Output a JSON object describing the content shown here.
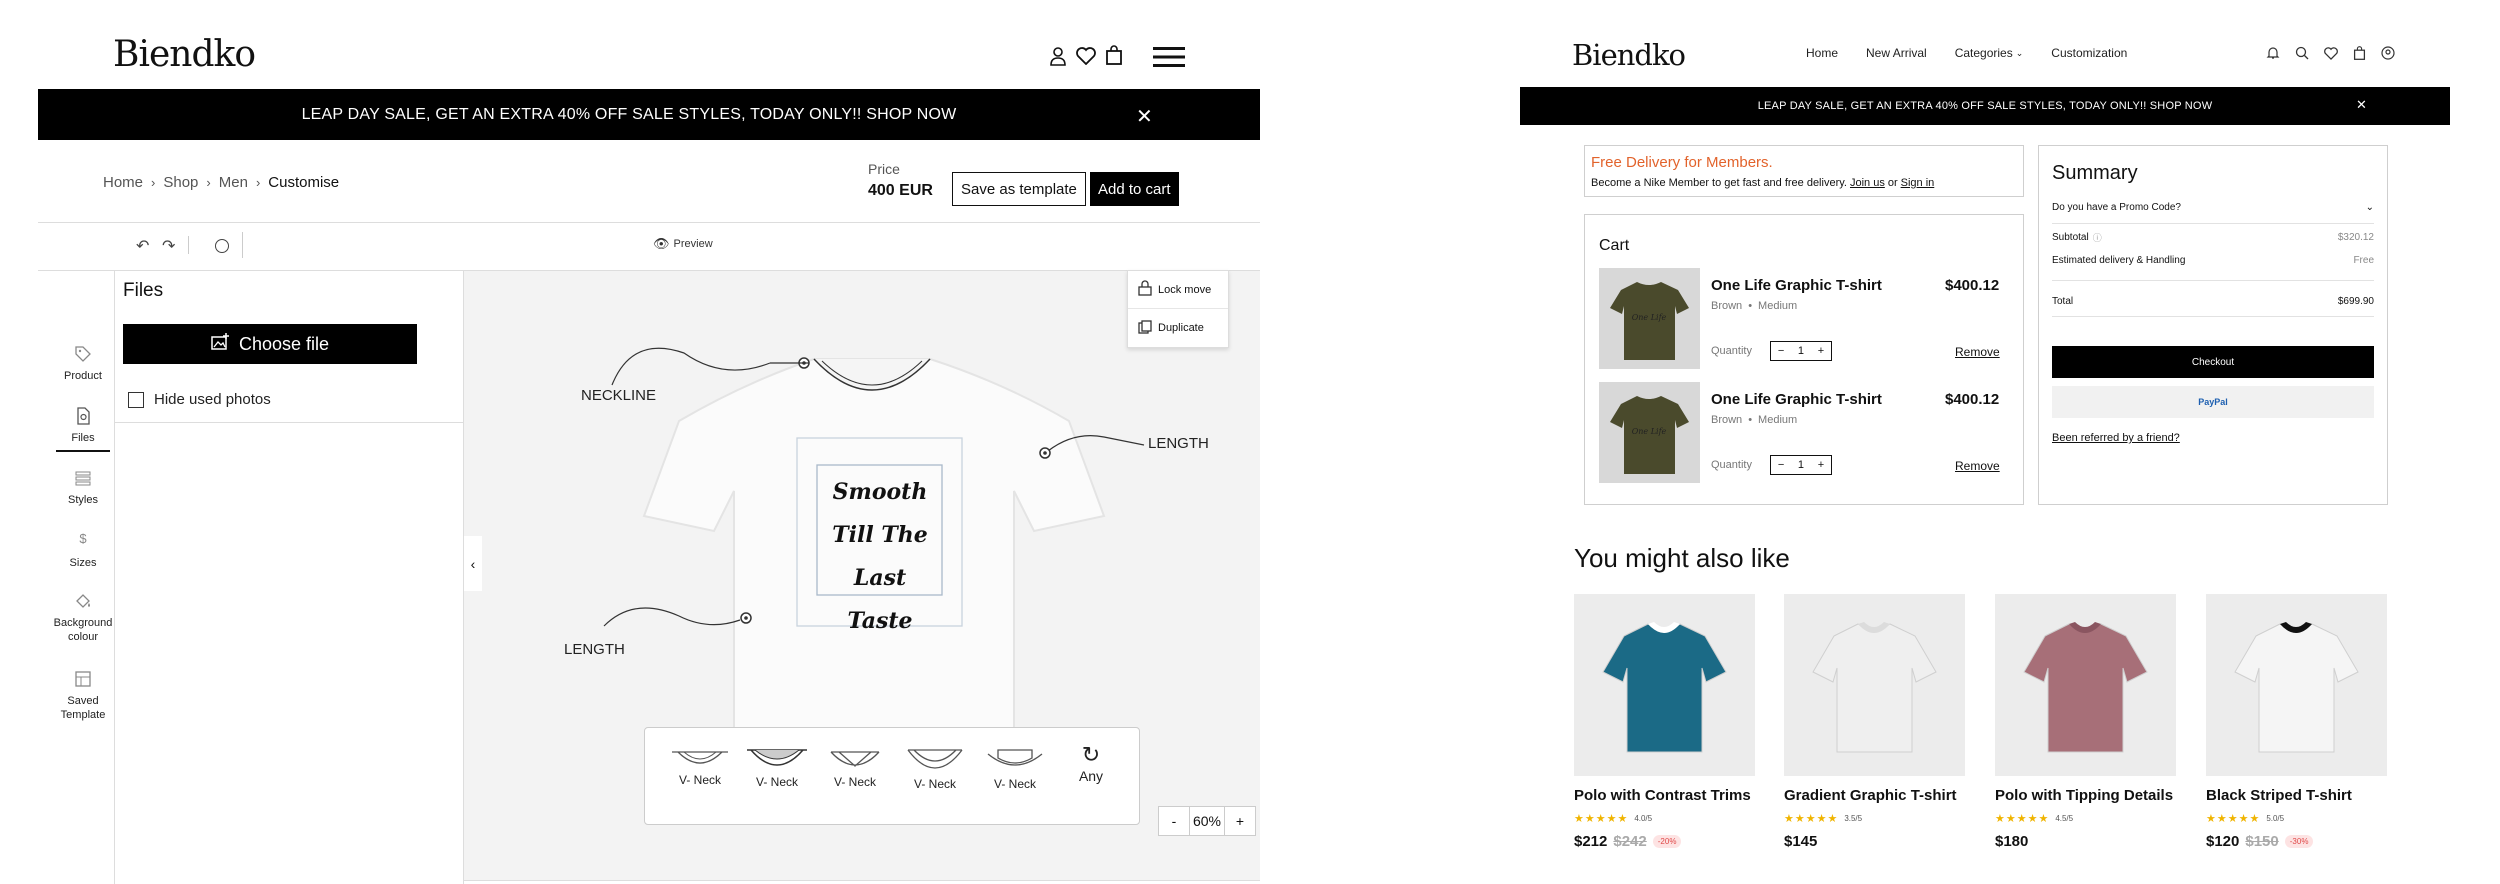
{
  "left": {
    "brand": "Biendko",
    "banner_text": "LEAP DAY SALE, GET AN EXTRA 40% OFF SALE STYLES, TODAY ONLY!! SHOP NOW",
    "breadcrumb": [
      "Home",
      "Shop",
      "Men",
      "Customise"
    ],
    "price_label": "Price",
    "price_value": "400 EUR",
    "save_template": "Save as template",
    "add_to_cart": "Add to cart",
    "preview": "Preview",
    "sidebar": [
      {
        "label": "Product",
        "icon": "tag-icon"
      },
      {
        "label": "Files",
        "icon": "file-icon"
      },
      {
        "label": "Styles",
        "icon": "styles-icon"
      },
      {
        "label": "Sizes",
        "icon": "dollar-icon"
      },
      {
        "label": "Background colour",
        "icon": "paint-bucket-icon"
      },
      {
        "label": "Saved Template",
        "icon": "template-icon"
      }
    ],
    "files_title": "Files",
    "choose_file": "Choose file",
    "hide_used": "Hide used photos",
    "context_menu": [
      "Lock move",
      "Duplicate"
    ],
    "annotations": {
      "neckline": "NECKLINE",
      "length_right": "LENGTH",
      "length_left": "LENGTH"
    },
    "print_text": [
      "Smooth",
      "Till The",
      "Last Taste"
    ],
    "necks": [
      "V- Neck",
      "V- Neck",
      "V- Neck",
      "V- Neck",
      "V- Neck",
      "Any"
    ],
    "zoom_minus": "-",
    "zoom_value": "60%",
    "zoom_plus": "+"
  },
  "right": {
    "brand": "Biendko",
    "nav": [
      "Home",
      "New Arrival",
      "Categories",
      "Customization"
    ],
    "banner_text": "LEAP DAY SALE, GET AN EXTRA 40% OFF SALE STYLES, TODAY ONLY!! SHOP NOW",
    "delivery_title": "Free Delivery for Members.",
    "delivery_text": "Become a Nike Member to get fast and free delivery.",
    "join_us": "Join us",
    "or": "or",
    "sign_in": "Sign in",
    "cart_title": "Cart",
    "cart_items": [
      {
        "name": "One Life Graphic T-shirt",
        "price": "$400.12",
        "color": "Brown",
        "size": "Medium",
        "qty_label": "Quantity",
        "qty": "1",
        "remove": "Remove"
      },
      {
        "name": "One Life Graphic T-shirt",
        "price": "$400.12",
        "color": "Brown",
        "size": "Medium",
        "qty_label": "Quantity",
        "qty": "1",
        "remove": "Remove"
      }
    ],
    "summary": {
      "title": "Summary",
      "promo": "Do you have a Promo Code?",
      "subtotal_label": "Subtotal",
      "subtotal": "$320.12",
      "delivery_label": "Estimated delivery & Handling",
      "delivery": "Free",
      "total_label": "Total",
      "total": "$699.90",
      "checkout": "Checkout",
      "paypal": "PayPal",
      "referred": "Been referred by a friend?"
    },
    "also_like_title": "You might also like",
    "products": [
      {
        "name": "Polo with Contrast Trims",
        "rating": "4.0/5",
        "price": "$212",
        "old_price": "$242",
        "discount": "-20%",
        "shirt_color": "#1b6a86",
        "collar_color": "#ffffff"
      },
      {
        "name": "Gradient Graphic T-shirt",
        "rating": "3.5/5",
        "price": "$145",
        "old_price": "",
        "discount": "",
        "shirt_color": "#efefef",
        "collar_color": "#dcdcdc"
      },
      {
        "name": "Polo with Tipping Details",
        "rating": "4.5/5",
        "price": "$180",
        "old_price": "",
        "discount": "",
        "shirt_color": "#a76f78",
        "collar_color": "#8a5560"
      },
      {
        "name": "Black Striped T-shirt",
        "rating": "5.0/5",
        "price": "$120",
        "old_price": "$150",
        "discount": "-30%",
        "shirt_color": "#f5f5f5",
        "collar_color": "#111111"
      }
    ]
  }
}
